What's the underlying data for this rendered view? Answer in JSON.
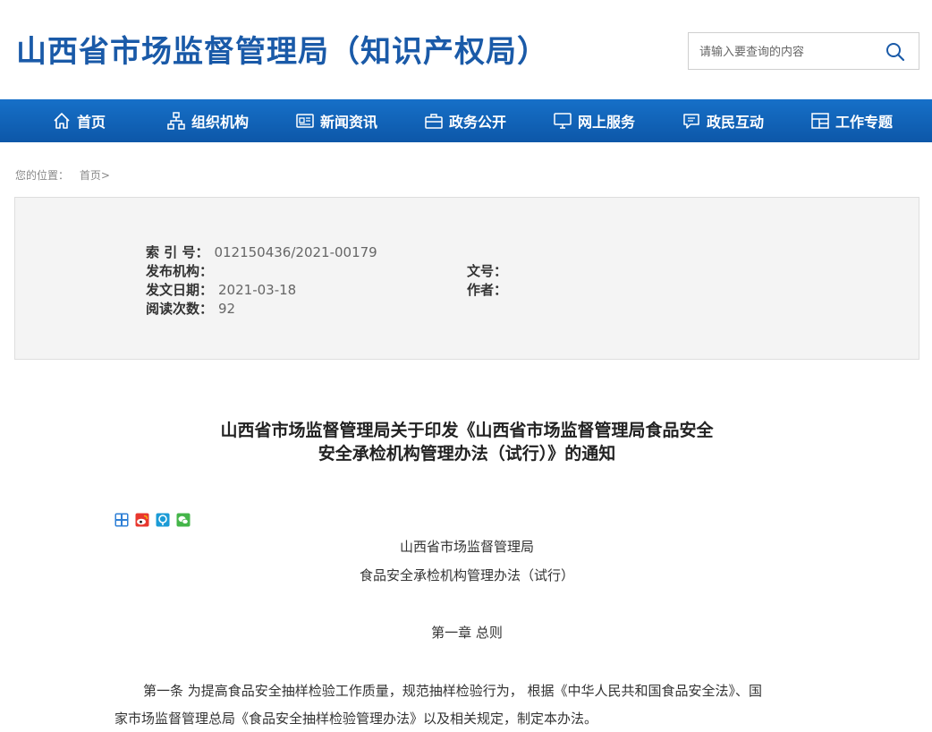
{
  "header": {
    "title": "山西省市场监督管理局（知识产权局）",
    "search_placeholder": "请输入要查询的内容",
    "search_icon": "search-icon"
  },
  "nav": {
    "items": [
      {
        "label": "首页",
        "icon": "home-icon"
      },
      {
        "label": "组织机构",
        "icon": "org-chart-icon"
      },
      {
        "label": "新闻资讯",
        "icon": "news-icon"
      },
      {
        "label": "政务公开",
        "icon": "briefcase-icon"
      },
      {
        "label": "网上服务",
        "icon": "monitor-icon"
      },
      {
        "label": "政民互动",
        "icon": "chat-icon"
      },
      {
        "label": "工作专题",
        "icon": "layout-icon"
      }
    ]
  },
  "breadcrumb": {
    "prefix": "您的位置：",
    "home": "首页>"
  },
  "meta": {
    "index_label": "索 引 号：",
    "index_value": "012150436/2021-00179",
    "publisher_label": "发布机构：",
    "publisher_value": "",
    "doc_no_label": "文号：",
    "doc_no_value": "",
    "date_label": "发文日期：",
    "date_value": "2021-03-18",
    "author_label": "作者：",
    "author_value": "",
    "reads_label": "阅读次数：",
    "reads_value": "92"
  },
  "article": {
    "title_line1": "山西省市场监督管理局关于印发《山西省市场监督管理局食品安全",
    "title_line2": "安全承检机构管理办法（试行）》的通知",
    "share_icons": [
      "share-plus-icon",
      "weibo-icon",
      "qzone-icon",
      "wechat-icon"
    ],
    "org_line": "山西省市场监督管理局",
    "doc_line": "食品安全承检机构管理办法（试行）",
    "chapter": "第一章  总则",
    "para1_line1": "第一条  为提高食品安全抽样检验工作质量，规范抽样检验行为， 根据《中华人民共和国食品安全法》、国",
    "para1_line2": "家市场监督管理总局《食品安全抽样检验管理办法》以及相关规定，制定本办法。"
  },
  "colors": {
    "brand_blue": "#1a5aa8",
    "nav_blue": "#1265bd",
    "panel_gray": "#f4f4f4"
  }
}
